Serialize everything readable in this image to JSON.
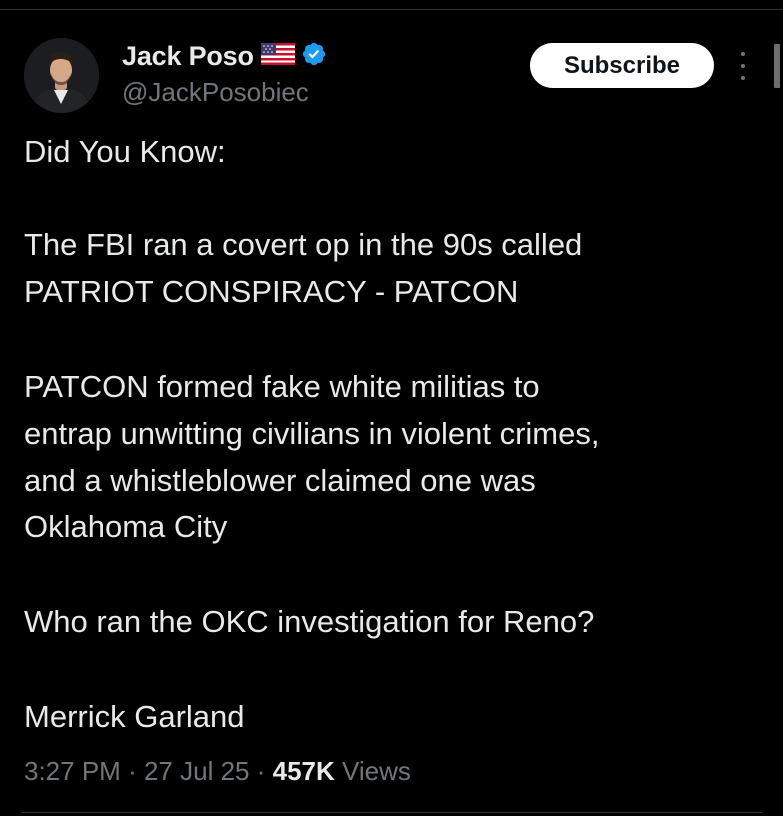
{
  "author": {
    "display_name": "Jack Poso",
    "handle": "@JackPosobiec",
    "flag_icon": "us-flag-icon",
    "verified_icon": "verified-badge-icon",
    "verified_color": "#1d9bf0"
  },
  "actions": {
    "subscribe_label": "Subscribe",
    "more_icon": "more-vertical-icon"
  },
  "tweet": {
    "lines": [
      "Did You Know:",
      "The FBI ran a covert op in the 90s called",
      "PATRIOT CONSPIRACY - PATCON",
      "PATCON formed fake white militias to",
      "entrap unwitting civilians in violent crimes,",
      "and a whistleblower claimed one was",
      "Oklahoma City",
      "Who ran the OKC investigation for Reno?",
      "Merrick Garland"
    ]
  },
  "meta": {
    "time": "3:27 PM",
    "separator": "·",
    "date": "27 Jul 25",
    "views_count": "457K",
    "views_label": "Views"
  },
  "colors": {
    "background": "#000000",
    "text": "#e7e9ea",
    "secondary": "#71767b",
    "divider": "#2f3336"
  }
}
